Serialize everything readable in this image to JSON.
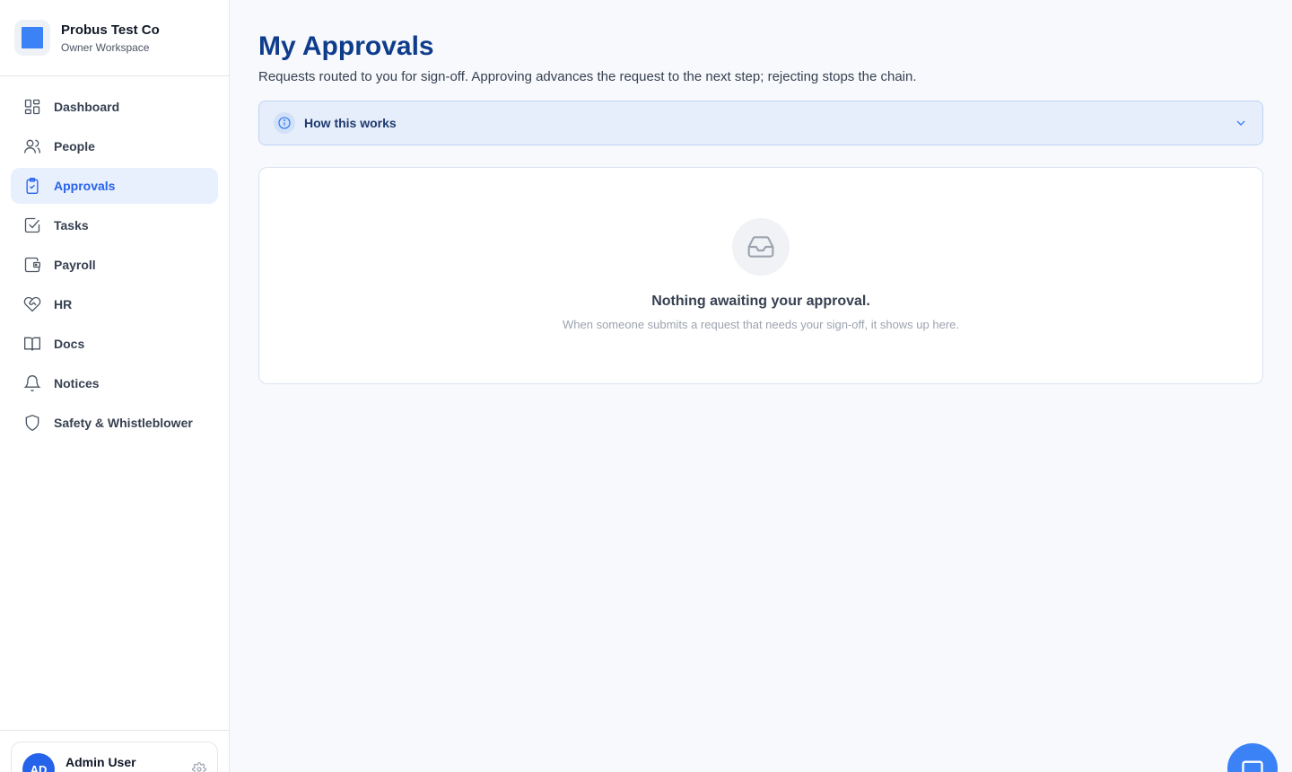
{
  "brand": {
    "name": "Probus Test Co",
    "subtitle": "Owner Workspace"
  },
  "sidebar": {
    "items": [
      {
        "label": "Dashboard",
        "icon": "grid-icon",
        "active": false
      },
      {
        "label": "People",
        "icon": "users-icon",
        "active": false
      },
      {
        "label": "Approvals",
        "icon": "clipboard-check-icon",
        "active": true
      },
      {
        "label": "Tasks",
        "icon": "checkbox-icon",
        "active": false
      },
      {
        "label": "Payroll",
        "icon": "wallet-icon",
        "active": false
      },
      {
        "label": "HR",
        "icon": "heart-handshake-icon",
        "active": false
      },
      {
        "label": "Docs",
        "icon": "book-icon",
        "active": false
      },
      {
        "label": "Notices",
        "icon": "bell-icon",
        "active": false
      },
      {
        "label": "Safety & Whistleblower",
        "icon": "shield-icon",
        "active": false
      }
    ]
  },
  "user": {
    "initials": "AD",
    "name": "Admin User"
  },
  "page": {
    "title": "My Approvals",
    "subtitle": "Requests routed to you for sign-off. Approving advances the request to the next step; rejecting stops the chain."
  },
  "info": {
    "label": "How this works"
  },
  "empty": {
    "title": "Nothing awaiting your approval.",
    "subtitle": "When someone submits a request that needs your sign-off, it shows up here."
  },
  "colors": {
    "accent": "#3b82f6",
    "title": "#0f3d8c",
    "active_bg": "#e8f0fe"
  }
}
